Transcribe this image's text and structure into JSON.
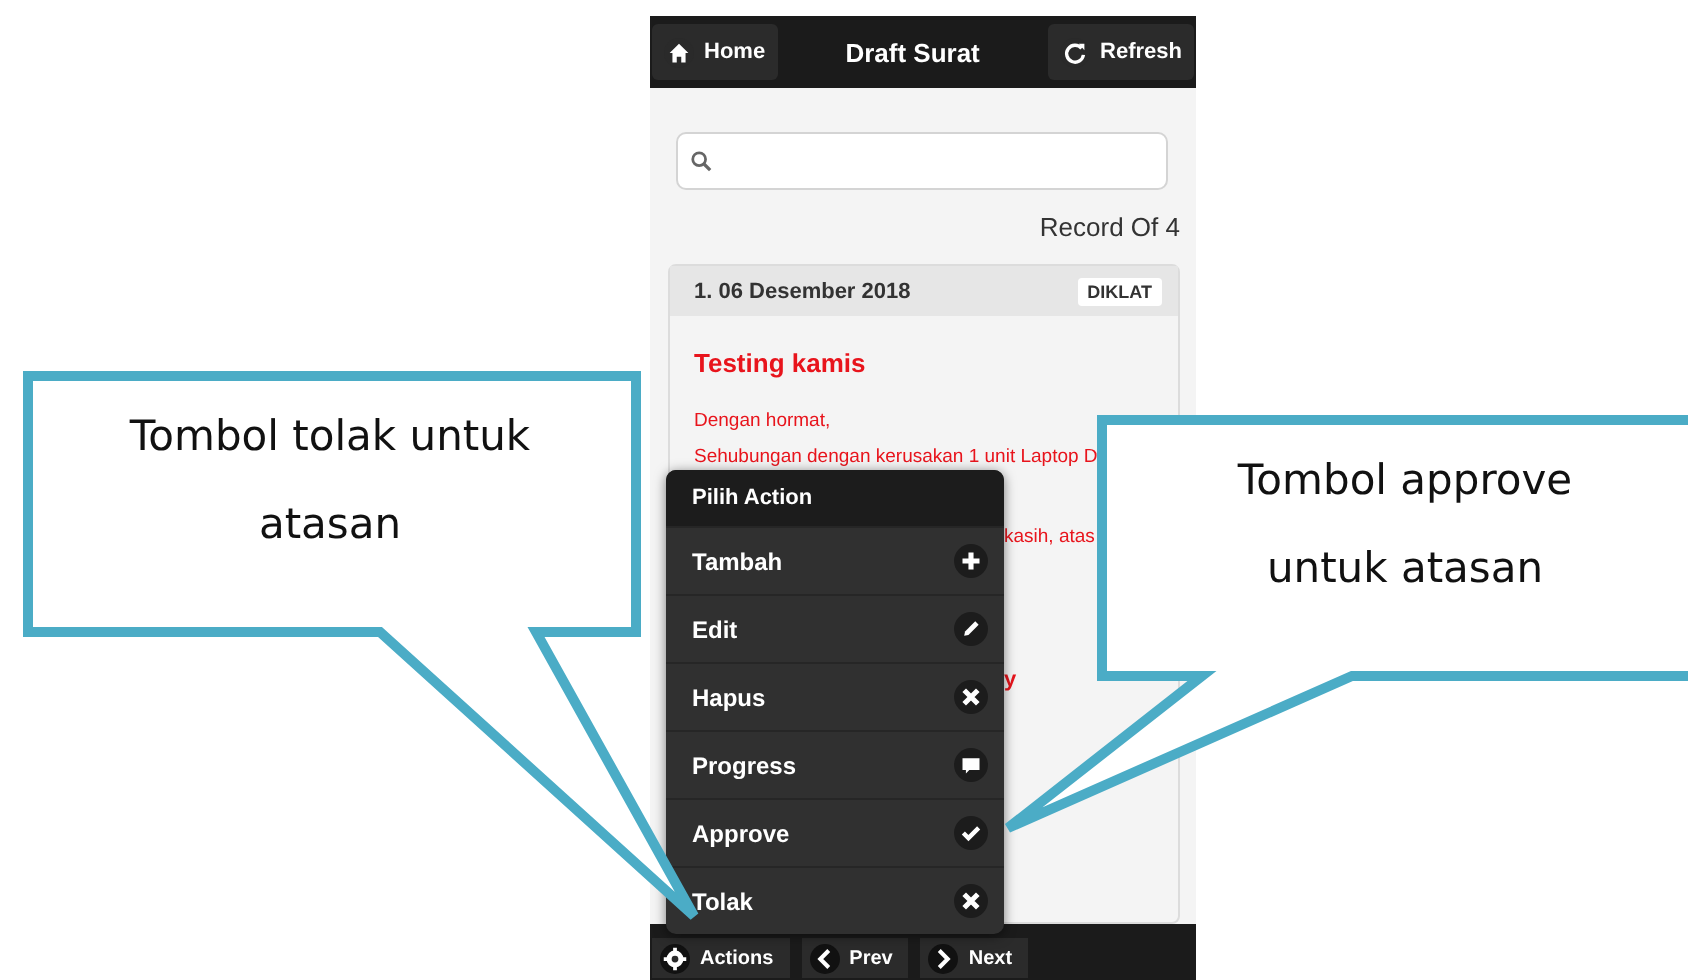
{
  "header": {
    "home": "Home",
    "title": "Draft Surat",
    "refresh": "Refresh"
  },
  "record_count": "Record Of 4",
  "card": {
    "date": "1. 06 Desember 2018",
    "tag": "DIKLAT",
    "title": "Testing kamis",
    "lines": [
      "Dengan hormat,",
      "Sehubungan dengan kerusakan 1 unit Laptop D"
    ],
    "fragments": [
      "kasih, atas",
      "y"
    ]
  },
  "menu": {
    "title": "Pilih Action",
    "items": [
      {
        "label": "Tambah",
        "kind": "plus"
      },
      {
        "label": "Edit",
        "kind": "pencil"
      },
      {
        "label": "Hapus",
        "kind": "cross"
      },
      {
        "label": "Progress",
        "kind": "comment"
      },
      {
        "label": "Approve",
        "kind": "check"
      },
      {
        "label": "Tolak",
        "kind": "cross"
      }
    ]
  },
  "bottom_bar": [
    {
      "label": "Actions",
      "kind": "gear"
    },
    {
      "label": "Prev",
      "kind": "left"
    },
    {
      "label": "Next",
      "kind": "right"
    }
  ],
  "callouts": [
    {
      "text": "Tombol tolak untuk atasan",
      "kind": "left"
    },
    {
      "text": "Tombol approve untuk atasan",
      "kind": "right"
    }
  ]
}
